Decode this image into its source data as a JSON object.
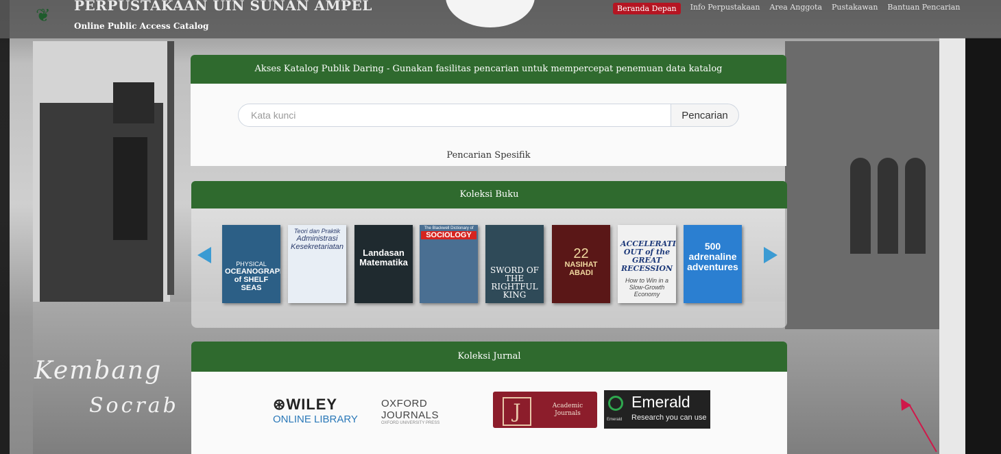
{
  "header": {
    "title": "PERPUSTAKAAN UIN SUNAN AMPEL",
    "subtitle": "Online Public Access Catalog",
    "nav": [
      {
        "label": "Beranda Depan",
        "active": true
      },
      {
        "label": "Info Perpustakaan",
        "active": false
      },
      {
        "label": "Area Anggota",
        "active": false
      },
      {
        "label": "Pustakawan",
        "active": false
      },
      {
        "label": "Bantuan Pencarian",
        "active": false
      }
    ]
  },
  "search": {
    "heading": "Akses Katalog Publik Daring - Gunakan fasilitas pencarian untuk mempercepat penemuan data katalog",
    "placeholder": "Kata kunci",
    "button_label": "Pencarian",
    "specific_label": "Pencarian Spesifik"
  },
  "books": {
    "heading": "Koleksi Buku",
    "items": [
      {
        "title": "OCEANOGRAPHY of SHELF SEAS",
        "subtitle": "PHYSICAL",
        "color": "#2c5f86"
      },
      {
        "title": "Administrasi Kesekretariatan",
        "subtitle": "Teori dan Praktik",
        "color": "#e8eef5"
      },
      {
        "title": "Landasan Matematika",
        "subtitle": "",
        "color": "#1f2a2f"
      },
      {
        "title": "SOCIOLOGY",
        "subtitle": "The Blackwell Dictionary of",
        "color": "#4a6f92"
      },
      {
        "title": "SWORD OF THE RIGHTFUL KING",
        "subtitle": "",
        "color": "#2f4a58"
      },
      {
        "title": "NASIHAT ABADI",
        "subtitle": "22",
        "color": "#5a1717"
      },
      {
        "title": "ACCELERATING OUT of the GREAT RECESSION",
        "subtitle": "How to Win in a Slow-Growth Economy",
        "color": "#f1f1f1"
      },
      {
        "title": "500 adrenaline adventures",
        "subtitle": "",
        "color": "#2b7fd1"
      }
    ]
  },
  "journals": {
    "heading": "Koleksi Jurnal",
    "wiley": {
      "line1": "WILEY",
      "line2": "ONLINE LIBRARY"
    },
    "oxford": {
      "line1": "OXFORD JOURNALS",
      "line2": "OXFORD UNIVERSITY PRESS"
    },
    "jstor": {
      "mark": "J",
      "line1": "Academic",
      "line2": "Journals"
    },
    "emerald": {
      "line1": "Emerald",
      "line2": "Research you can use",
      "small": "Emerald"
    }
  },
  "background": {
    "signature_line1": "Kembang",
    "signature_line2": "Socrab"
  },
  "colors": {
    "panel_header": "#2f6a2e",
    "nav_active": "#b51522",
    "carousel_arrow": "#3b9bd3"
  }
}
